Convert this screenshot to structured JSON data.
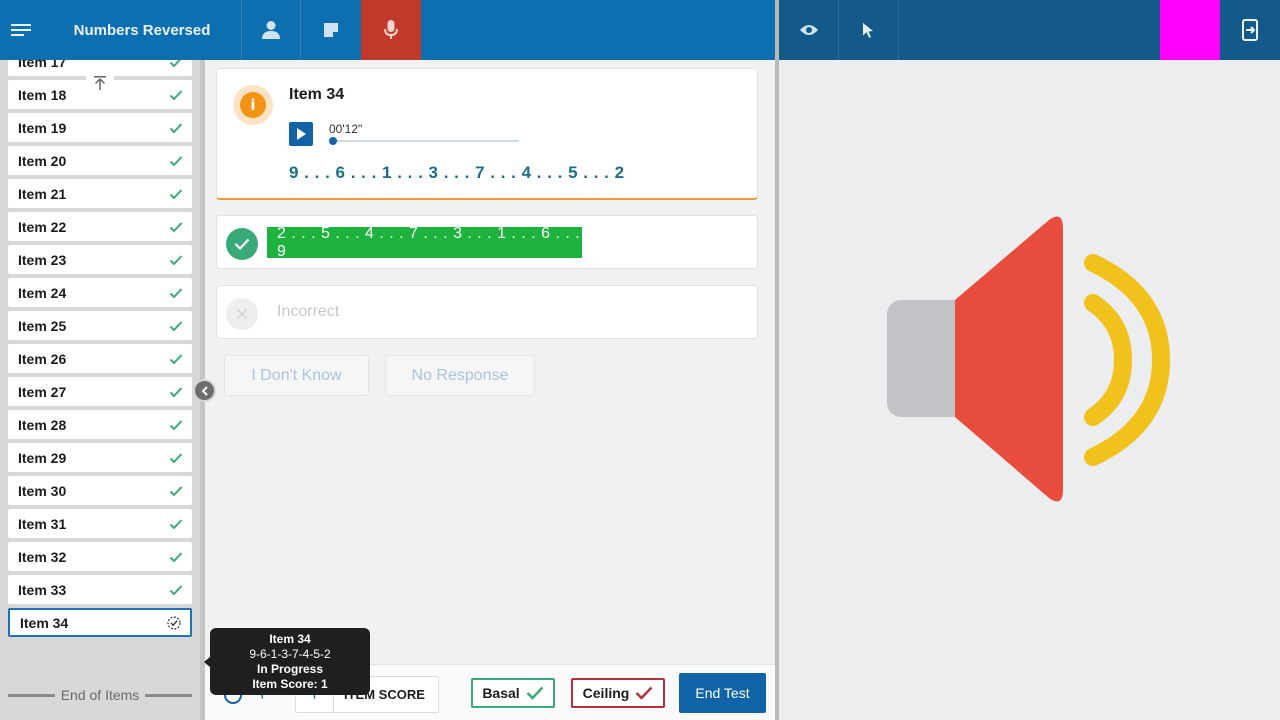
{
  "header": {
    "test_title": "Numbers Reversed",
    "icons": [
      "menu-icon",
      "person-icon",
      "note-icon",
      "microphone-icon",
      "eye-icon",
      "pointer-icon",
      "exit-icon"
    ],
    "mic_active_color": "#c0392b",
    "accent_color": "#0d6eb0",
    "highlight_block_color": "#ff00ff"
  },
  "sidebar": {
    "items": [
      {
        "label": "Item 17",
        "status": "complete"
      },
      {
        "label": "Item 18",
        "status": "complete"
      },
      {
        "label": "Item 19",
        "status": "complete"
      },
      {
        "label": "Item 20",
        "status": "complete"
      },
      {
        "label": "Item 21",
        "status": "complete"
      },
      {
        "label": "Item 22",
        "status": "complete"
      },
      {
        "label": "Item 23",
        "status": "complete"
      },
      {
        "label": "Item 24",
        "status": "complete"
      },
      {
        "label": "Item 25",
        "status": "complete"
      },
      {
        "label": "Item 26",
        "status": "complete"
      },
      {
        "label": "Item 27",
        "status": "complete"
      },
      {
        "label": "Item 28",
        "status": "complete"
      },
      {
        "label": "Item 29",
        "status": "complete"
      },
      {
        "label": "Item 30",
        "status": "complete"
      },
      {
        "label": "Item 31",
        "status": "complete"
      },
      {
        "label": "Item 32",
        "status": "complete"
      },
      {
        "label": "Item 33",
        "status": "complete"
      },
      {
        "label": "Item 34",
        "status": "in-progress"
      }
    ],
    "end_label": "End of Items"
  },
  "current_item": {
    "title": "Item 34",
    "audio_time": "00'12\"",
    "sequence": "9 . . . 6 . . . 1 . . . 3 . . . 7 . . . 4 . . . 5 . . . 2",
    "correct_answer": "2 . . . 5 . . . 4 . . . 7 . . . 3 . . . 1 . . . 6 . . . 9",
    "incorrect_label": "Incorrect"
  },
  "responses": {
    "dont_know": "I Don't Know",
    "no_response": "No Response"
  },
  "bottom_bar": {
    "item_score_label": "ITEM SCORE",
    "basal_label": "Basal",
    "ceiling_label": "Ceiling",
    "end_test_label": "End Test"
  },
  "tooltip": {
    "title": "Item 34",
    "sequence": "9-6-1-3-7-4-5-2",
    "status": "In Progress",
    "score": "Item Score: 1"
  },
  "right_panel": {
    "graphic": "speaker-volume-icon",
    "colors": {
      "speaker_body": "#c1c3c6",
      "speaker_cone": "#e74c3c",
      "sound_waves": "#f1c21b"
    }
  }
}
